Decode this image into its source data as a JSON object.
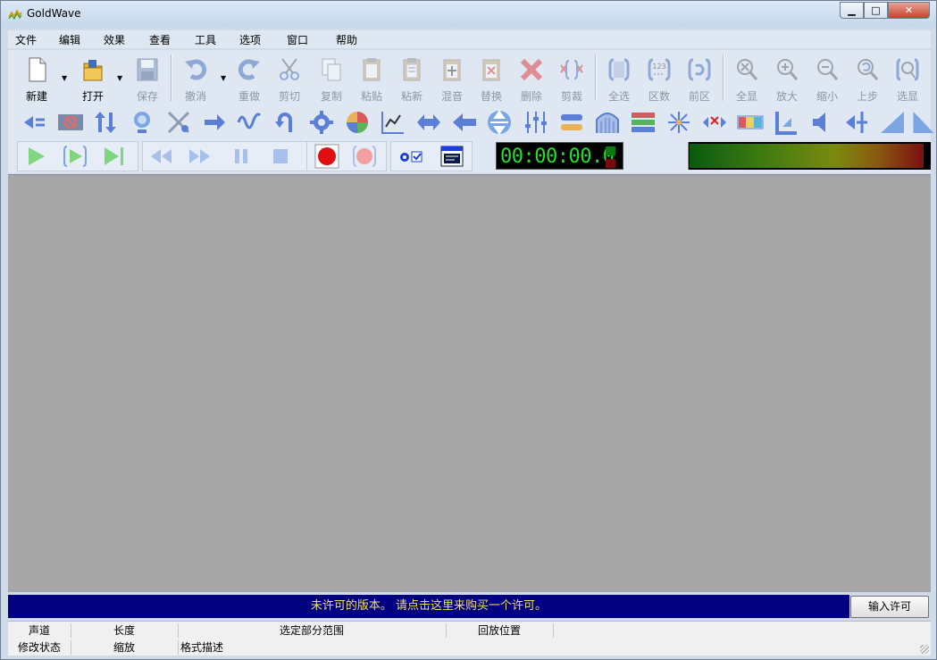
{
  "window": {
    "title": "GoldWave",
    "minimize": "▁",
    "maximize": "□",
    "close": "✕"
  },
  "menu": [
    "文件",
    "编辑",
    "效果",
    "查看",
    "工具",
    "选项",
    "窗口",
    "帮助"
  ],
  "toolbar": {
    "new": "新建",
    "open": "打开",
    "save": "保存",
    "undo": "撤消",
    "redo": "重做",
    "cut": "剪切",
    "copy": "复制",
    "paste": "粘贴",
    "paste_new": "粘新",
    "mix": "混音",
    "replace": "替换",
    "delete": "删除",
    "trim": "剪裁",
    "select_all": "全选",
    "cue": "区数",
    "previous": "前区",
    "show_all": "全显",
    "zoom_in": "放大",
    "zoom_out": "缩小",
    "zoom_prev": "上步",
    "show_selection": "选显",
    "cue_text": "123"
  },
  "transport": {
    "time": "00:00:00.0"
  },
  "banner": {
    "text": "未许可的版本。 请点击这里来购买一个许可。",
    "button": "输入许可"
  },
  "status": {
    "row1": [
      "声道",
      "长度",
      "选定部分范围",
      "回放位置"
    ],
    "row2": [
      "修改状态",
      "缩放",
      "格式描述"
    ]
  },
  "colors": {
    "banner_bg": "#000080",
    "banner_text": "#f0e060",
    "time_text": "#22e02a",
    "workarea": "#a6a6a6",
    "window_bg": "#cfdbe8"
  }
}
